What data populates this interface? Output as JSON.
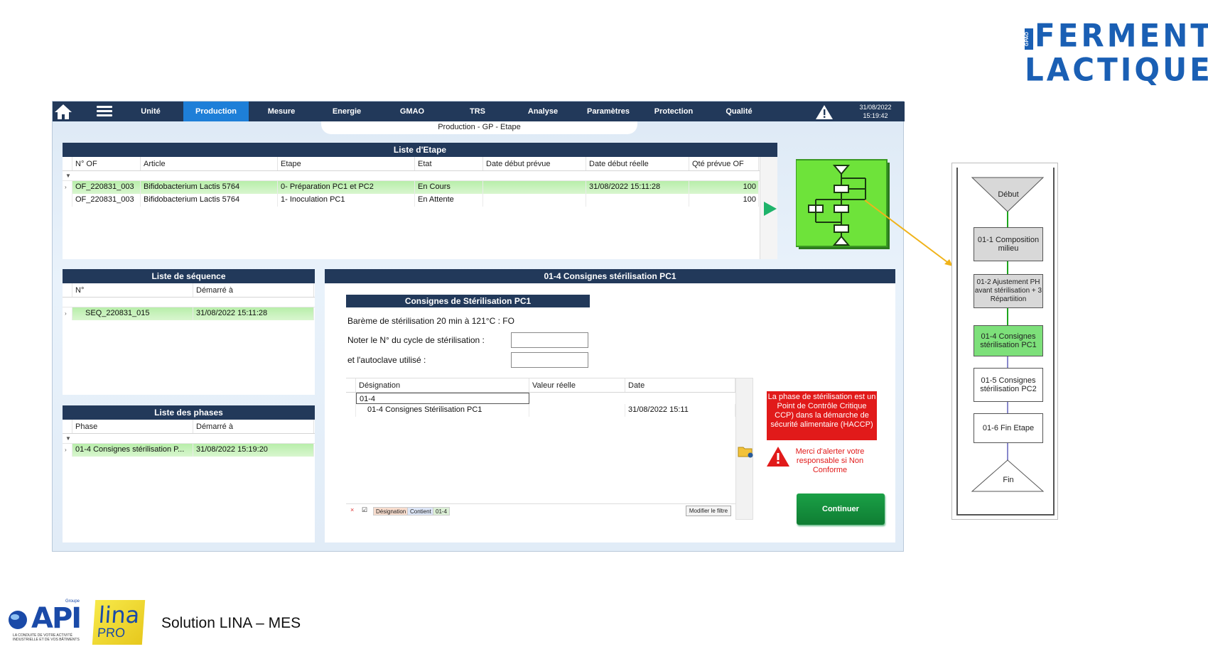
{
  "brand": {
    "line1": "FERMENTS",
    "line2": "LACTIQUES",
    "tag": "GPAO"
  },
  "topbar": {
    "nav": [
      "Unité",
      "Production",
      "Mesure",
      "Energie",
      "GMAO",
      "TRS",
      "Analyse",
      "Paramètres",
      "Protection",
      "Qualité"
    ],
    "active": "Production",
    "date": "31/08/2022",
    "time": "15:19:42"
  },
  "tab_label": "Production - GP - Etape",
  "etape_panel": {
    "title": "Liste d'Etape",
    "columns": [
      "N° OF",
      "Article",
      "Etape",
      "Etat",
      "Date début prévue",
      "Date début réelle",
      "Qté prévue OF"
    ],
    "rows": [
      [
        "OF_220831_003",
        "Bifidobacterium Lactis 5764",
        "0- Préparation PC1 et PC2",
        "En Cours",
        "",
        "31/08/2022 15:11:28",
        "100"
      ],
      [
        "OF_220831_003",
        "Bifidobacterium Lactis 5764",
        "1- Inoculation PC1",
        "En Attente",
        "",
        "",
        "100"
      ]
    ]
  },
  "sequence_panel": {
    "title": "Liste de séquence",
    "columns": [
      "N°",
      "Démarré à"
    ],
    "rows": [
      [
        "SEQ_220831_015",
        "31/08/2022 15:11:28"
      ]
    ]
  },
  "phase_panel": {
    "title": "Liste des phases",
    "columns": [
      "Phase",
      "Démarré à"
    ],
    "rows": [
      [
        "01-4 Consignes stérilisation P...",
        "31/08/2022 15:19:20"
      ]
    ]
  },
  "main_panel": {
    "title": "01-4 Consignes stérilisation PC1",
    "subtitle": "Consignes de Stérilisation PC1",
    "bareme": "Barème de stérilisation 20 min à 121°C : FO",
    "cycle_label": "Noter le N° du cycle de stérilisation :",
    "autoclave_label": "et l'autoclave utilisé :",
    "cycle_value": "",
    "autoclave_value": "",
    "grid_columns": [
      "Désignation",
      "Valeur réelle",
      "Date"
    ],
    "grid_filter": "01-4",
    "grid_rows": [
      [
        "01-4 Consignes Stérilisation PC1",
        "",
        "31/08/2022 15:11"
      ]
    ],
    "filter_chips": [
      "Désignation",
      "Contient",
      "01-4"
    ],
    "modify_filter": "Modifier le filtre",
    "haccp": "La phase de stérilisation est un Point de Contrôle Critique CCP) dans la démarche de sécurité alimentaire (HACCP)",
    "alert": "Merci d'alerter votre responsable si Non Conforme",
    "continue_label": "Continuer"
  },
  "flow": {
    "start": "Début",
    "steps": [
      "01-1 Composition milieu",
      "01-2 Ajustement PH avant stérilisation + 3 Répartiition",
      "01-4 Consignes stérilisation PC1",
      "01-5 Consignes stérilisation PC2",
      "01-6 Fin Etape"
    ],
    "end": "Fin",
    "active_step": "01-4 Consignes stérilisation PC1"
  },
  "footer": {
    "api_logo": "API",
    "api_group": "Groupe",
    "api_tagline": "LA CONDUITE DE VOTRE ACTIVITÉ INDUSTRIELLE ET DE VOS BÂTIMENTS",
    "lina_logo": "lina",
    "lina_pro": "PRO",
    "text": "Solution LINA – MES"
  }
}
